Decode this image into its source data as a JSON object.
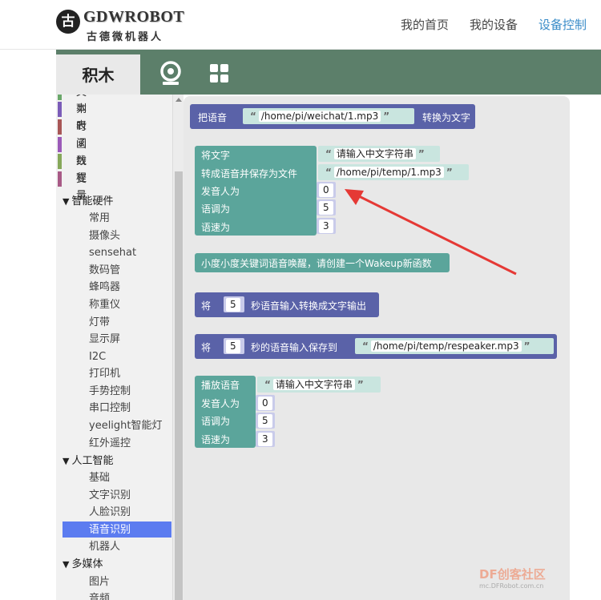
{
  "header": {
    "logo_mark": "古",
    "logo_title": "GDWROBOT",
    "logo_subtitle": "古德微机器人",
    "nav": [
      {
        "label": "我的首页",
        "active": false
      },
      {
        "label": "我的设备",
        "active": false
      },
      {
        "label": "设备控制",
        "active": true
      }
    ]
  },
  "toolbar": {
    "tab_blocks": "积木",
    "icons": [
      "camera-icon",
      "grid-icon"
    ]
  },
  "sidebar": {
    "categories": [
      {
        "label": "文本",
        "color": "#6aa86a"
      },
      {
        "label": "列表",
        "color": "#7b5cb8"
      },
      {
        "label": "时间",
        "color": "#a85656"
      },
      {
        "label": "函数",
        "color": "#9b5ab8"
      },
      {
        "label": "线程",
        "color": "#86a85a"
      },
      {
        "label": "变量",
        "color": "#a85a86"
      }
    ],
    "groups": [
      {
        "label": "智能硬件",
        "items": [
          "常用",
          "摄像头",
          "sensehat",
          "数码管",
          "蜂鸣器",
          "称重仪",
          "灯带",
          "显示屏",
          "I2C",
          "打印机",
          "手势控制",
          "串口控制",
          "yeelight智能灯",
          "红外遥控"
        ]
      },
      {
        "label": "人工智能",
        "items": [
          "基础",
          "文字识别",
          "人脸识别",
          "语音识别",
          "机器人"
        ]
      },
      {
        "label": "多媒体",
        "items": [
          "图片",
          "音频"
        ]
      }
    ],
    "selected": "语音识别"
  },
  "blocks": {
    "b1": {
      "prefix": "把语音",
      "value": "/home/pi/weichat/1.mp3",
      "suffix": "转换为文字"
    },
    "b2": {
      "row1_label": "将文字",
      "row1_value": "请输入中文字符串",
      "row2_label": "转成语音并保存为文件",
      "row2_value": "/home/pi/temp/1.mp3",
      "row3_label": "发音人为",
      "row3_value": "0",
      "row4_label": "语调为",
      "row4_value": "5",
      "row5_label": "语速为",
      "row5_value": "3"
    },
    "b3": {
      "label": "小度小度关键词语音唤醒，请创建一个Wakeup新函数"
    },
    "b4": {
      "prefix": "将",
      "value": "5",
      "suffix": "秒语音输入转换成文字输出"
    },
    "b5": {
      "prefix": "将",
      "value": "5",
      "mid": "秒的语音输入保存到",
      "path": "/home/pi/temp/respeaker.mp3"
    },
    "b6": {
      "row1_label": "播放语音",
      "row1_value": "请输入中文字符串",
      "row2_label": "发音人为",
      "row2_value": "0",
      "row3_label": "语调为",
      "row3_value": "5",
      "row4_label": "语速为",
      "row4_value": "3"
    }
  },
  "watermark": {
    "brand": "DF创客社区",
    "url": "mc.DFRobot.com.cn"
  },
  "colors": {
    "toolbar": "#5c7f6a",
    "nav_active": "#3a8cc8",
    "selected": "#5c7cf0",
    "block_purple": "#5a62a8",
    "block_teal": "#5ba59b",
    "arrow": "#e53935"
  }
}
